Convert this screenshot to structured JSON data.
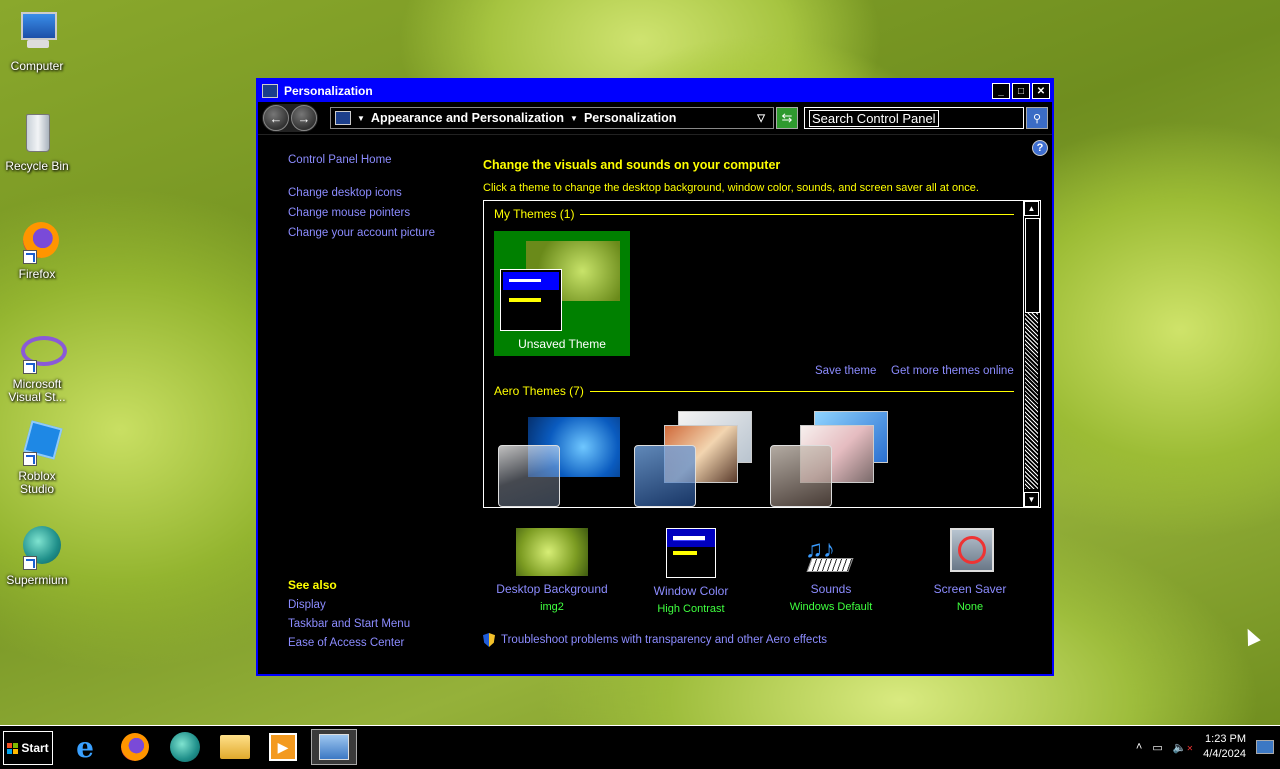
{
  "desktop": {
    "icons": [
      {
        "label": "Computer"
      },
      {
        "label": "Recycle Bin"
      },
      {
        "label": "Firefox"
      },
      {
        "label": "Microsoft Visual St..."
      },
      {
        "label": "Roblox Studio"
      },
      {
        "label": "Supermium"
      }
    ]
  },
  "window": {
    "title": "Personalization",
    "breadcrumb": [
      "Appearance and Personalization",
      "Personalization"
    ],
    "search_placeholder": "Search Control Panel",
    "left_links": {
      "home": "Control Panel Home",
      "items": [
        "Change desktop icons",
        "Change mouse pointers",
        "Change your account picture"
      ]
    },
    "see_also": {
      "header": "See also",
      "items": [
        "Display",
        "Taskbar and Start Menu",
        "Ease of Access Center"
      ]
    },
    "heading": "Change the visuals and sounds on your computer",
    "description": "Click a theme to change the desktop background, window color, sounds, and screen saver all at once.",
    "my_themes": {
      "header": "My Themes (1)",
      "tile_label": "Unsaved Theme",
      "save_link": "Save theme",
      "more_link": "Get more themes online"
    },
    "aero_themes": {
      "header": "Aero Themes (7)"
    },
    "options": [
      {
        "name": "Desktop Background",
        "value": "img2",
        "icon": "wallpaper-thumbnail"
      },
      {
        "name": "Window Color",
        "value": "High Contrast",
        "icon": "window-color-icon"
      },
      {
        "name": "Sounds",
        "value": "Windows Default",
        "icon": "sounds-icon"
      },
      {
        "name": "Screen Saver",
        "value": "None",
        "icon": "screensaver-icon"
      }
    ],
    "troubleshoot": "Troubleshoot problems with transparency and other Aero effects"
  },
  "taskbar": {
    "start_label": "Start",
    "apps": [
      "internet-explorer",
      "firefox",
      "supermium",
      "file-explorer",
      "media-player",
      "control-panel"
    ],
    "time": "1:23 PM",
    "date": "4/4/2024"
  },
  "colors": {
    "title_bar": "#0000ff",
    "link": "#8c8cff",
    "heading": "#ffff00",
    "value": "#3fff3f"
  }
}
